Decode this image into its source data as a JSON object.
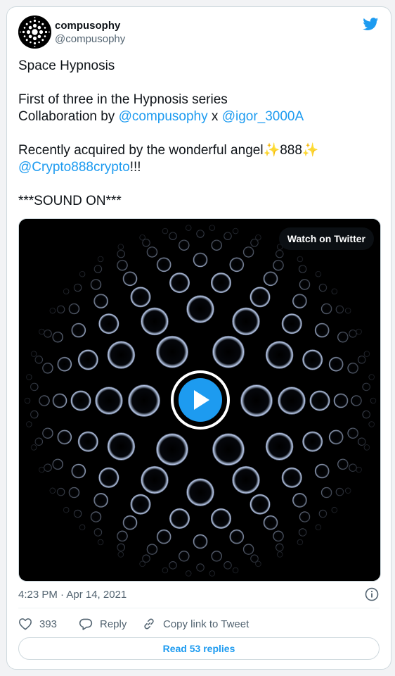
{
  "author": {
    "display_name": "compusophy",
    "handle": "@compusophy",
    "avatar_icon": "dot-sphere-avatar"
  },
  "brand": {
    "icon": "twitter-bird-icon",
    "color": "#1d9bf0"
  },
  "tweet": {
    "line1": "Space Hypnosis",
    "line2": "First of three in the Hypnosis series",
    "line3_prefix": "Collaboration by ",
    "line3_mention1": "@compusophy",
    "line3_sep": " x ",
    "line3_mention2": "@igor_3000A",
    "line4": "Recently acquired by the wonderful angel✨888✨",
    "line5_mention": "@Crypto888crypto",
    "line5_suffix": "!!!",
    "line6": "***SOUND ON***"
  },
  "media": {
    "watch_label": "Watch on Twitter",
    "play_icon": "play-icon"
  },
  "meta": {
    "timestamp": "4:23 PM · Apr 14, 2021",
    "info_icon": "info-icon"
  },
  "actions": {
    "likes": "393",
    "reply_label": "Reply",
    "copy_label": "Copy link to Tweet"
  },
  "read_replies": "Read 53 replies",
  "colors": {
    "link": "#1d9bf0",
    "muted": "#536471",
    "border": "#cfd9de"
  }
}
